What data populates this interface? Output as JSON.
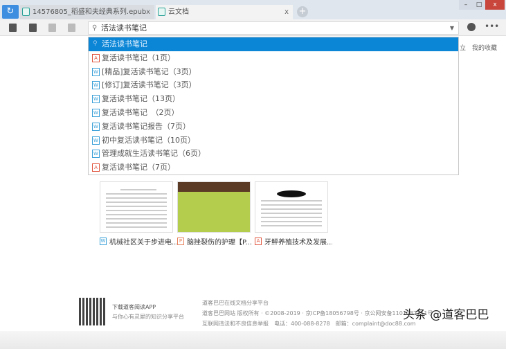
{
  "tabs": [
    {
      "label": "14576805_稻盛和夫经典系列.epub",
      "close": "x"
    },
    {
      "label": "云文档",
      "close": "x"
    }
  ],
  "new_tab": "+",
  "window_controls": [
    "–",
    "□",
    "x"
  ],
  "search": {
    "value": "活法读书笔记"
  },
  "suggestions": [
    {
      "label": "活法读书笔记",
      "type": "search",
      "selected": true
    },
    {
      "label": "复活读书笔记（1页）",
      "type": "pdf"
    },
    {
      "label": "[精品]复活读书笔记（3页）",
      "type": "word"
    },
    {
      "label": "[修订]复活读书笔记（3页）",
      "type": "word"
    },
    {
      "label": "复活读书笔记（13页）",
      "type": "word"
    },
    {
      "label": "复活读书笔记　（2页）",
      "type": "word"
    },
    {
      "label": "复活读书笔记报告（7页）",
      "type": "word"
    },
    {
      "label": "初中复活读书笔记（10页）",
      "type": "word"
    },
    {
      "label": "管理成就生活读书笔记（6页）",
      "type": "word"
    },
    {
      "label": "复活读书笔记（7页）",
      "type": "pdf"
    }
  ],
  "right_links": [
    "立",
    "我的收藏"
  ],
  "docs": [
    {
      "title": "机械社区关于步进电...",
      "type": "word",
      "icon": "W"
    },
    {
      "title": "脑挫裂伤的护理【P...",
      "type": "ppt",
      "icon": "P"
    },
    {
      "title": "牙鲆养殖技术及发展...",
      "type": "pdf",
      "icon": "A"
    }
  ],
  "footer": {
    "app_title": "下载道客阅读APP",
    "app_sub": "与你心有灵犀的知识分享平台",
    "line1": "道客巴巴在线文档分享平台",
    "line2": "道客巴巴网站 版权所有 · ©2008-2019 · 京ICP备18056798号 · 京公网安备1101082111号",
    "line3": "互联网违法和不良信息举报　电话：400-088-8278　邮箱：complaint@doc88.com"
  },
  "watermark": "头条 @道客巴巴"
}
